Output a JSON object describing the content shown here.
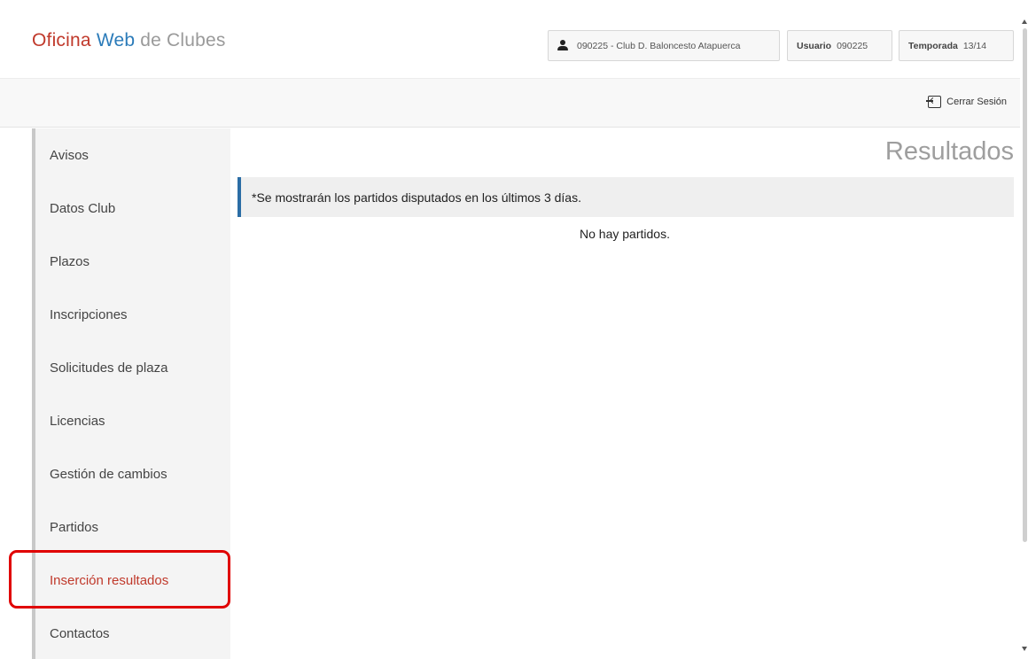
{
  "header": {
    "logo": {
      "part1": "Oficina",
      "part2": "Web",
      "part3": "de Clubes"
    },
    "club": "090225 - Club D. Baloncesto Atapuerca",
    "user_label": "Usuario",
    "user_value": "090225",
    "season_label": "Temporada",
    "season_value": "13/14"
  },
  "toolbar": {
    "logout_label": "Cerrar Sesión"
  },
  "sidebar": {
    "items": [
      {
        "label": "Avisos"
      },
      {
        "label": "Datos Club"
      },
      {
        "label": "Plazos"
      },
      {
        "label": "Inscripciones"
      },
      {
        "label": "Solicitudes de plaza"
      },
      {
        "label": "Licencias"
      },
      {
        "label": "Gestión de cambios"
      },
      {
        "label": "Partidos"
      },
      {
        "label": "Inserción resultados"
      },
      {
        "label": "Contactos"
      }
    ]
  },
  "main": {
    "title": "Resultados",
    "notice": "*Se mostrarán los partidos disputados en los últimos 3 días.",
    "empty_message": "No hay partidos."
  },
  "colors": {
    "brand_red": "#c0392b",
    "brand_blue": "#2b7bb9",
    "notice_border": "#2b6da5",
    "highlight": "#e00000"
  }
}
